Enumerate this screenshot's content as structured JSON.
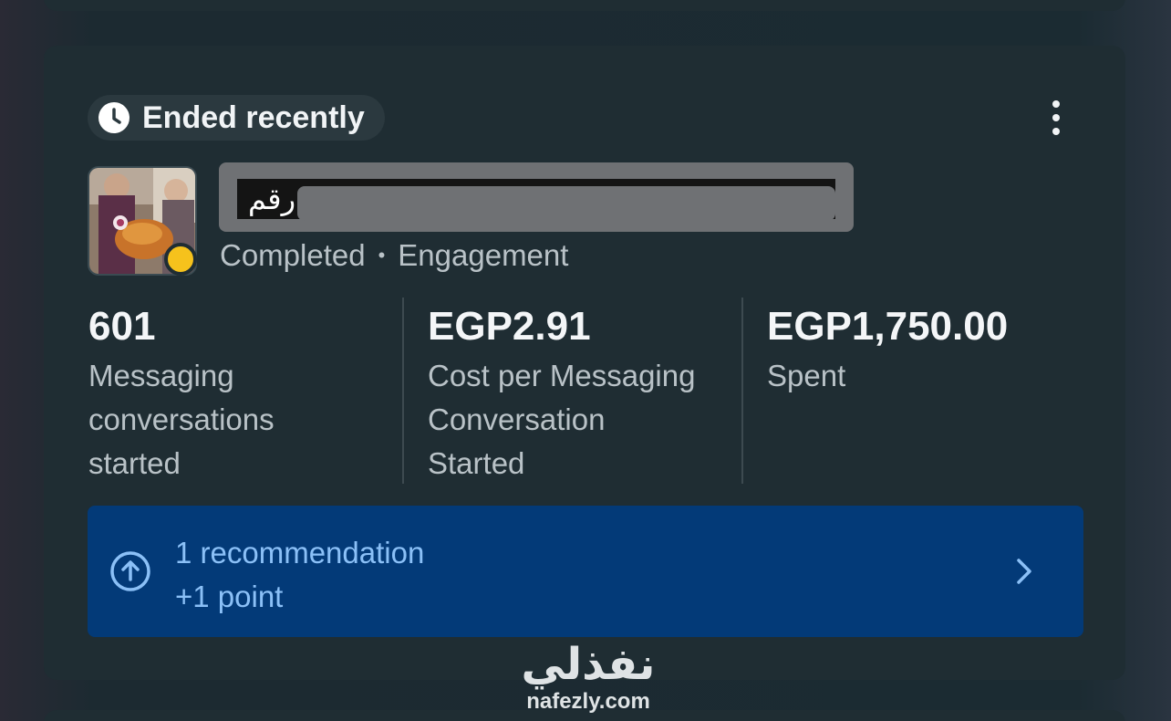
{
  "card": {
    "status_label": "Ended recently",
    "ad_name": "رقم",
    "state": "Completed",
    "separator": "•",
    "objective": "Engagement",
    "status_dot_color": "#f6c21c"
  },
  "metrics": [
    {
      "value": "601",
      "label_lines": [
        "Messaging",
        "conversations",
        "started"
      ]
    },
    {
      "value": "EGP2.91",
      "label_lines": [
        "Cost per Messaging",
        "Conversation",
        "Started"
      ]
    },
    {
      "value": "EGP1,750.00",
      "label_lines": [
        "Spent"
      ]
    }
  ],
  "recommendation": {
    "title": "1 recommendation",
    "subtitle": "+1 point",
    "icon": "arrow-up-circle-icon"
  },
  "watermark": {
    "logo_text": "نفذلي",
    "url": "nafezly.com"
  },
  "colors": {
    "card_bg": "#1f2d33",
    "recommendation_bg": "#033a78",
    "recommendation_text": "#8bc0f7"
  }
}
